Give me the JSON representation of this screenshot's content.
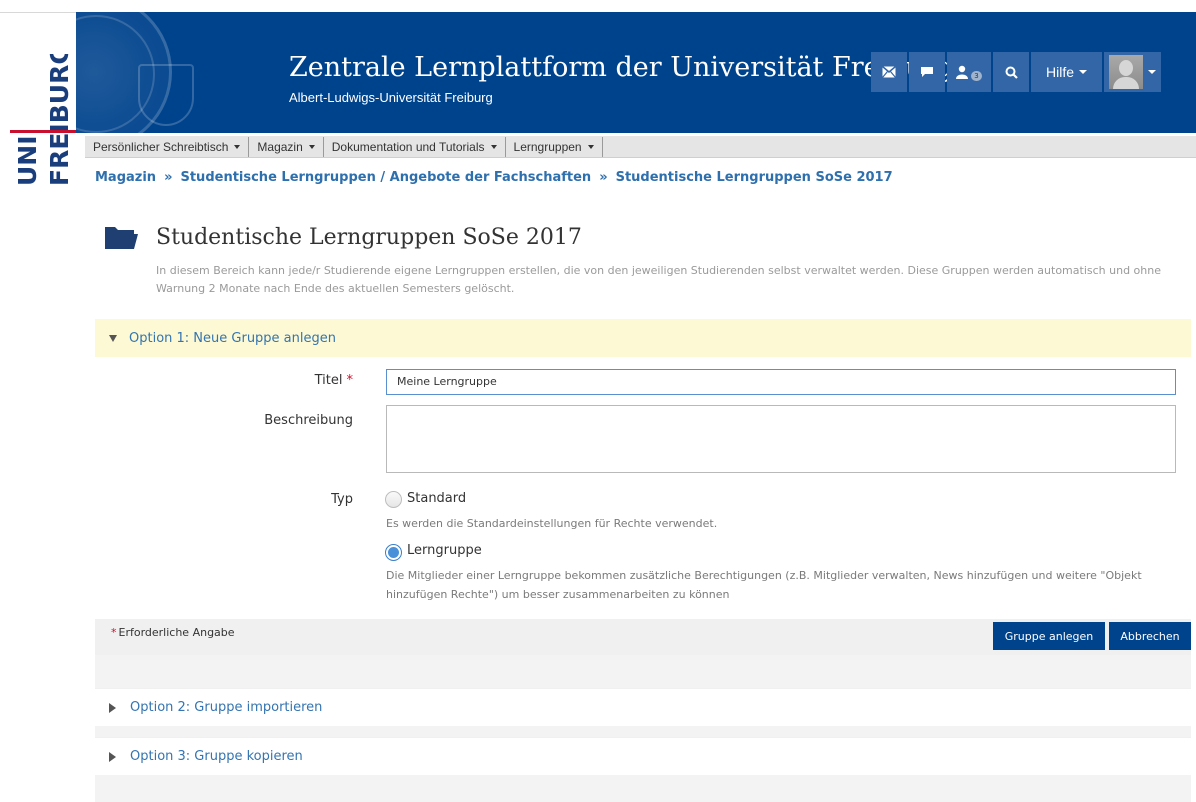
{
  "logo": {
    "line1": "UNI",
    "line2": "FREIBURG"
  },
  "header": {
    "title": "Zentrale Lernplattform der Universität Freiburg",
    "subtitle": "Albert-Ludwigs-Universität Freiburg",
    "icons": [
      "mail-icon",
      "chat-icon",
      "users-icon",
      "search-icon"
    ],
    "user_badge": "3",
    "help_label": "Hilfe"
  },
  "menu": {
    "items": [
      {
        "label": "Persönlicher Schreibtisch"
      },
      {
        "label": "Magazin"
      },
      {
        "label": "Dokumentation und Tutorials"
      },
      {
        "label": "Lerngruppen"
      }
    ]
  },
  "breadcrumb": {
    "items": [
      "Magazin",
      "Studentische Lerngruppen / Angebote der Fachschaften",
      "Studentische Lerngruppen SoSe 2017"
    ],
    "separator": "»"
  },
  "page": {
    "title": "Studentische Lerngruppen SoSe 2017",
    "description": "In diesem Bereich kann jede/r Studierende eigene Lerngruppen erstellen, die von den jeweiligen Studierenden selbst verwaltet werden. Diese Gruppen werden automatisch und ohne Warnung 2 Monate nach Ende des aktuellen Semesters gelöscht."
  },
  "option1": {
    "label": "Option 1: Neue Gruppe anlegen",
    "fields": {
      "title_label": "Titel",
      "title_value": "Meine Lerngruppe",
      "desc_label": "Beschreibung",
      "desc_value": "",
      "type_label": "Typ"
    },
    "types": [
      {
        "label": "Standard",
        "help": "Es werden die Standardeinstellungen für Rechte verwendet.",
        "checked": false
      },
      {
        "label": "Lerngruppe",
        "help": "Die Mitglieder einer Lerngruppe bekommen zusätzliche Berechtigungen (z.B. Mitglieder verwalten, News hinzufügen und weitere \"Objekt hinzufügen Rechte\") um besser zusammenarbeiten zu können",
        "checked": true
      }
    ],
    "required_star": "*",
    "required_note": "Erforderliche Angabe",
    "create_button": "Gruppe anlegen",
    "cancel_button": "Abbrechen"
  },
  "option2": {
    "label": "Option 2: Gruppe importieren"
  },
  "option3": {
    "label": "Option 3: Gruppe kopieren"
  },
  "colors": {
    "brand_blue": "#00438d",
    "link_blue": "#2e6fad",
    "accent_red": "#c8102e",
    "highlight_yellow": "#fcf9d4"
  }
}
